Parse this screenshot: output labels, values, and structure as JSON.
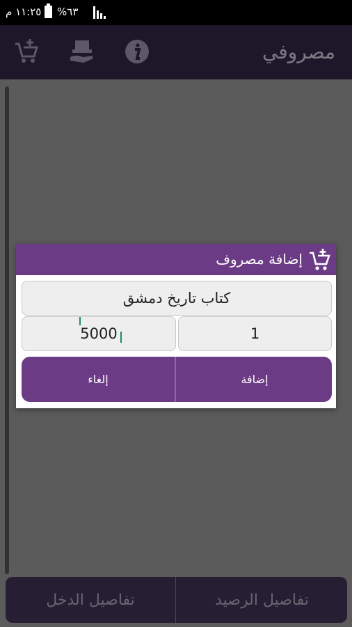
{
  "status_bar": {
    "time": "١١:٢٥ م",
    "battery": "%٦٣"
  },
  "app_bar": {
    "title": "مصروفي"
  },
  "dialog": {
    "title": "إضافة مصروف",
    "item_name": "كتاب تاريخ دمشق",
    "quantity": "1",
    "price": "5000",
    "add_label": "إضافة",
    "cancel_label": "إلغاء"
  },
  "bottom_nav": {
    "balance_details": "تفاصيل الرصيد",
    "income_details": "تفاصيل الدخل"
  },
  "colors": {
    "accent": "#6c3b85",
    "app_bar": "#1d1729",
    "overlay": "#5b5b5b"
  }
}
